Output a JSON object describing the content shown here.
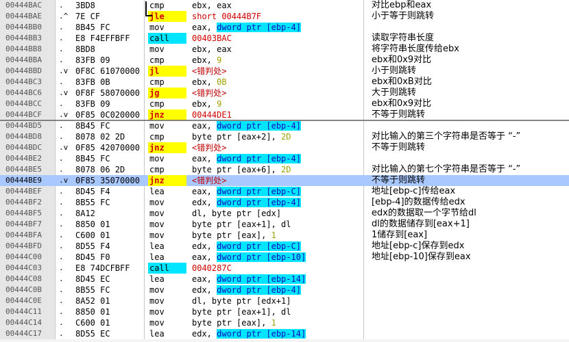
{
  "disasm": {
    "rows": [
      {
        "addr": "00444BAC",
        "mark": ".",
        "hex": "3BD8",
        "mnemonic": "cmp",
        "type": "normal",
        "ops": [
          {
            "t": "ebx, eax",
            "c": ""
          }
        ],
        "comment": "对比ebp和eax"
      },
      {
        "addr": "00444BAE",
        "mark": ".^",
        "hex": "7E CF",
        "mnemonic": "jle",
        "type": "jump",
        "ops": [
          {
            "t": "short 00444B7F",
            "c": "target"
          }
        ],
        "comment": "小于等于则跳转"
      },
      {
        "addr": "00444BB0",
        "mark": ".",
        "hex": "8B45 FC",
        "mnemonic": "mov",
        "type": "normal",
        "ops": [
          {
            "t": "eax, ",
            "c": ""
          },
          {
            "t": "dword ptr [ebp-4]",
            "c": "ptr"
          }
        ],
        "comment": ""
      },
      {
        "addr": "00444BB3",
        "mark": ".",
        "hex": "E8 F4EFFBFF",
        "mnemonic": "call",
        "type": "call",
        "ops": [
          {
            "t": "00403BAC",
            "c": "target"
          }
        ],
        "comment": "读取字符串长度"
      },
      {
        "addr": "00444BB8",
        "mark": ".",
        "hex": "8BD8",
        "mnemonic": "mov",
        "type": "normal",
        "ops": [
          {
            "t": "ebx, eax",
            "c": ""
          }
        ],
        "comment": "将字符串长度传给ebx"
      },
      {
        "addr": "00444BBA",
        "mark": ".",
        "hex": "83FB 09",
        "mnemonic": "cmp",
        "type": "normal",
        "ops": [
          {
            "t": "ebx, ",
            "c": ""
          },
          {
            "t": "9",
            "c": "num"
          }
        ],
        "comment": "ebx和0x9对比"
      },
      {
        "addr": "00444BBD",
        "mark": ".v",
        "hex": "0F8C 61070000",
        "mnemonic": "jl",
        "type": "jump",
        "ops": [
          {
            "t": "<错判处>",
            "c": "red"
          }
        ],
        "comment": "小于则跳转"
      },
      {
        "addr": "00444BC3",
        "mark": ".",
        "hex": "83FB 0B",
        "mnemonic": "cmp",
        "type": "normal",
        "ops": [
          {
            "t": "ebx, ",
            "c": ""
          },
          {
            "t": "0B",
            "c": "num"
          }
        ],
        "comment": "ebx和0xB对比"
      },
      {
        "addr": "00444BC6",
        "mark": ".v",
        "hex": "0F8F 58070000",
        "mnemonic": "jg",
        "type": "jump",
        "ops": [
          {
            "t": "<错判处>",
            "c": "red"
          }
        ],
        "comment": "大于则跳转"
      },
      {
        "addr": "00444BCC",
        "mark": ".",
        "hex": "83FB 09",
        "mnemonic": "cmp",
        "type": "normal",
        "ops": [
          {
            "t": "ebx, ",
            "c": ""
          },
          {
            "t": "9",
            "c": "num"
          }
        ],
        "comment": "ebx和0x9对比"
      },
      {
        "addr": "00444BCF",
        "mark": ".v",
        "hex": "0F85 0C020000",
        "mnemonic": "jnz",
        "type": "jump",
        "ops": [
          {
            "t": "00444DE1",
            "c": "target"
          }
        ],
        "comment": "不等于则跳转"
      },
      {
        "addr": "00444BD5",
        "mark": ".",
        "hex": "8B45 FC",
        "mnemonic": "mov",
        "type": "normal",
        "ops": [
          {
            "t": "eax, ",
            "c": ""
          },
          {
            "t": "dword ptr [ebp-4]",
            "c": "ptr"
          }
        ],
        "comment": ""
      },
      {
        "addr": "00444BD8",
        "mark": ".",
        "hex": "8078 02 2D",
        "mnemonic": "cmp",
        "type": "normal",
        "ops": [
          {
            "t": "byte ptr [eax+2], ",
            "c": ""
          },
          {
            "t": "2D",
            "c": "num"
          }
        ],
        "comment": "对比输入的第三个字符串是否等于 “-”"
      },
      {
        "addr": "00444BDC",
        "mark": ".v",
        "hex": "0F85 42070000",
        "mnemonic": "jnz",
        "type": "jump",
        "ops": [
          {
            "t": "<错判处>",
            "c": "red"
          }
        ],
        "comment": "不等于则跳转"
      },
      {
        "addr": "00444BE2",
        "mark": ".",
        "hex": "8B45 FC",
        "mnemonic": "mov",
        "type": "normal",
        "ops": [
          {
            "t": "eax, ",
            "c": ""
          },
          {
            "t": "dword ptr [ebp-4]",
            "c": "ptr"
          }
        ],
        "comment": ""
      },
      {
        "addr": "00444BE5",
        "mark": ".",
        "hex": "8078 06 2D",
        "mnemonic": "cmp",
        "type": "normal",
        "ops": [
          {
            "t": "byte ptr [eax+6], ",
            "c": ""
          },
          {
            "t": "2D",
            "c": "num"
          }
        ],
        "comment": "对比输入的第七个字符串是否等于 “-”"
      },
      {
        "addr": "00444BE9",
        "mark": ".v",
        "hex": "0F85 35070000",
        "mnemonic": "jnz",
        "type": "jump",
        "selected": true,
        "ops": [
          {
            "t": "<错判处>",
            "c": "red"
          }
        ],
        "comment": "不等于则跳转"
      },
      {
        "addr": "00444BEF",
        "mark": ".",
        "hex": "8D45 F4",
        "mnemonic": "lea",
        "type": "normal",
        "ops": [
          {
            "t": "eax, ",
            "c": ""
          },
          {
            "t": "dword ptr [ebp-C]",
            "c": "ptr"
          }
        ],
        "comment": "地址[ebp-c]传给eax"
      },
      {
        "addr": "00444BF2",
        "mark": ".",
        "hex": "8B55 FC",
        "mnemonic": "mov",
        "type": "normal",
        "ops": [
          {
            "t": "edx, ",
            "c": ""
          },
          {
            "t": "dword ptr [ebp-4]",
            "c": "ptr"
          }
        ],
        "comment": "[ebp-4]的数据传给edx"
      },
      {
        "addr": "00444BF5",
        "mark": ".",
        "hex": "8A12",
        "mnemonic": "mov",
        "type": "normal",
        "ops": [
          {
            "t": "dl, byte ptr [edx]",
            "c": ""
          }
        ],
        "comment": "edx的数据取一个字节给dl"
      },
      {
        "addr": "00444BF7",
        "mark": ".",
        "hex": "8850 01",
        "mnemonic": "mov",
        "type": "normal",
        "ops": [
          {
            "t": "byte ptr [eax+1], dl",
            "c": ""
          }
        ],
        "comment": "dl的数据储存到[eax+1]"
      },
      {
        "addr": "00444BFA",
        "mark": ".",
        "hex": "C600 01",
        "mnemonic": "mov",
        "type": "normal",
        "ops": [
          {
            "t": "byte ptr [eax], ",
            "c": ""
          },
          {
            "t": "1",
            "c": "num"
          }
        ],
        "comment": "1储存到[eax]"
      },
      {
        "addr": "00444BFD",
        "mark": ".",
        "hex": "8D55 F4",
        "mnemonic": "lea",
        "type": "normal",
        "ops": [
          {
            "t": "edx, ",
            "c": ""
          },
          {
            "t": "dword ptr [ebp-C]",
            "c": "ptr"
          }
        ],
        "comment": "地址[ebp-c]保存到edx"
      },
      {
        "addr": "00444C00",
        "mark": ".",
        "hex": "8D45 F0",
        "mnemonic": "lea",
        "type": "normal",
        "ops": [
          {
            "t": "eax, ",
            "c": ""
          },
          {
            "t": "dword ptr [ebp-10]",
            "c": "ptr"
          }
        ],
        "comment": "地址[ebp-10]保存到eax"
      },
      {
        "addr": "00444C03",
        "mark": ".",
        "hex": "E8 74DCFBFF",
        "mnemonic": "call",
        "type": "call",
        "ops": [
          {
            "t": "0040287C",
            "c": "target"
          }
        ],
        "comment": ""
      },
      {
        "addr": "00444C08",
        "mark": ".",
        "hex": "8D45 EC",
        "mnemonic": "lea",
        "type": "normal",
        "ops": [
          {
            "t": "eax, ",
            "c": ""
          },
          {
            "t": "dword ptr [ebp-14]",
            "c": "ptr"
          }
        ],
        "comment": ""
      },
      {
        "addr": "00444C0B",
        "mark": ".",
        "hex": "8B55 FC",
        "mnemonic": "mov",
        "type": "normal",
        "ops": [
          {
            "t": "edx, ",
            "c": ""
          },
          {
            "t": "dword ptr [ebp-4]",
            "c": "ptr"
          }
        ],
        "comment": ""
      },
      {
        "addr": "00444C0E",
        "mark": ".",
        "hex": "8A52 01",
        "mnemonic": "mov",
        "type": "normal",
        "ops": [
          {
            "t": "dl, byte ptr [edx+1]",
            "c": ""
          }
        ],
        "comment": ""
      },
      {
        "addr": "00444C11",
        "mark": ".",
        "hex": "8850 01",
        "mnemonic": "mov",
        "type": "normal",
        "ops": [
          {
            "t": "byte ptr [eax+1], dl",
            "c": ""
          }
        ],
        "comment": ""
      },
      {
        "addr": "00444C14",
        "mark": ".",
        "hex": "C600 01",
        "mnemonic": "mov",
        "type": "normal",
        "ops": [
          {
            "t": "byte ptr [eax], ",
            "c": ""
          },
          {
            "t": "1",
            "c": "num"
          }
        ],
        "comment": ""
      },
      {
        "addr": "00444C17",
        "mark": ".",
        "hex": "8D55 EC",
        "mnemonic": "lea",
        "type": "normal",
        "ops": [
          {
            "t": "edx, ",
            "c": ""
          },
          {
            "t": "dword ptr [ebp-14]",
            "c": "ptr"
          }
        ],
        "comment": ""
      }
    ]
  },
  "colors": {
    "selection": "#a8c8ff",
    "call_highlight": "#00e5ff",
    "jump_highlight": "#ffff00",
    "jump_text": "#d00000",
    "address_column": "#e6e6e6"
  }
}
